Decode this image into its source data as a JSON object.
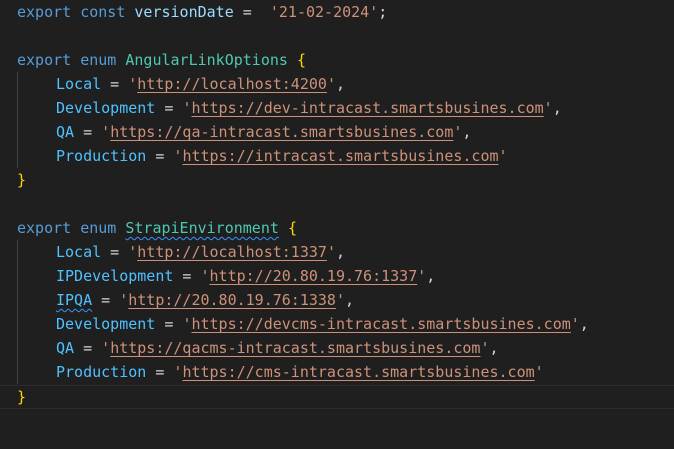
{
  "code": {
    "version": {
      "export": "export",
      "const": "const",
      "name": "versionDate",
      "eq": " = ",
      "value": "'21-02-2024'",
      "end": ";"
    },
    "angular": {
      "export": "export",
      "enum": "enum",
      "name": "AngularLinkOptions",
      "open": "{",
      "close": "}",
      "members": [
        {
          "name": "Local",
          "q1": "'",
          "url": "http://localhost:4200",
          "q2": "'",
          "end": ","
        },
        {
          "name": "Development",
          "q1": "'",
          "url": "https://dev-intracast.smartsbusines.com",
          "q2": "'",
          "end": ","
        },
        {
          "name": "QA",
          "q1": "'",
          "url": "https://qa-intracast.smartsbusines.com",
          "q2": "'",
          "end": ","
        },
        {
          "name": "Production",
          "q1": "'",
          "url": "https://intracast.smartsbusines.com",
          "q2": "'",
          "end": ""
        }
      ]
    },
    "strapi": {
      "export": "export",
      "enum": "enum",
      "name": "StrapiEnvironment",
      "open": "{",
      "close": "}",
      "members": [
        {
          "name": "Local",
          "q1": "'",
          "url": "http://localhost:1337",
          "q2": "'",
          "end": ","
        },
        {
          "name": "IPDevelopment",
          "q1": "'",
          "url": "http://20.80.19.76:1337",
          "q2": "'",
          "end": ","
        },
        {
          "name": "IPQA",
          "q1": "'",
          "url": "http://20.80.19.76:1338",
          "q2": "'",
          "end": ","
        },
        {
          "name": "Development",
          "q1": "'",
          "url": "https://devcms-intracast.smartsbusines.com",
          "q2": "'",
          "end": ","
        },
        {
          "name": "QA",
          "q1": "'",
          "url": "https://qacms-intracast.smartsbusines.com",
          "q2": "'",
          "end": ","
        },
        {
          "name": "Production",
          "q1": "'",
          "url": "https://cms-intracast.smartsbusines.com",
          "q2": "'",
          "end": ""
        }
      ]
    },
    "eq": " = "
  },
  "colors": {
    "background": "#1f1f1f",
    "keyword": "#569cd6",
    "type": "#4ec9b0",
    "variable": "#9cdcfe",
    "member": "#4fc1ff",
    "string": "#ce9178",
    "brace": "#ffd700"
  }
}
